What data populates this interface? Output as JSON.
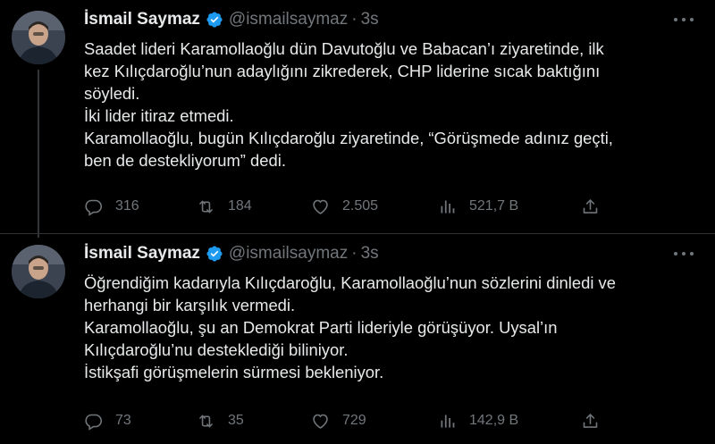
{
  "tweets": [
    {
      "author_name": "İsmail Saymaz",
      "handle": "@ismailsaymaz",
      "separator": "·",
      "time": "3s",
      "lines": [
        "Saadet lideri Karamollaoğlu dün Davutoğlu ve Babacan’ı ziyaretinde, ilk",
        "kez Kılıçdaroğlu’nun adaylığını zikrederek, CHP liderine sıcak baktığını",
        "söyledi.",
        "İki lider itiraz etmedi.",
        "Karamollaoğlu, bugün Kılıçdaroğlu ziyaretinde, “Görüşmede adınız geçti,",
        "ben de destekliyorum” dedi."
      ],
      "replies": "316",
      "retweets": "184",
      "likes": "2.505",
      "views": "521,7 B"
    },
    {
      "author_name": "İsmail Saymaz",
      "handle": "@ismailsaymaz",
      "separator": "·",
      "time": "3s",
      "lines": [
        "Öğrendiğim kadarıyla Kılıçdaroğlu, Karamollaoğlu’nun sözlerini dinledi ve",
        "herhangi bir karşılık vermedi.",
        "Karamollaoğlu, şu an Demokrat Parti lideriyle görüşüyor. Uysal’ın",
        "Kılıçdaroğlu’nu desteklediği biliniyor.",
        "İstikşafi görüşmelerin sürmesi bekleniyor."
      ],
      "replies": "73",
      "retweets": "35",
      "likes": "729",
      "views": "142,9 B"
    }
  ],
  "icons": {
    "verified": "verified-badge-icon",
    "more": "more-dots-icon",
    "reply": "reply-icon",
    "retweet": "retweet-icon",
    "like": "heart-icon",
    "views": "views-icon",
    "share": "share-icon"
  },
  "colors": {
    "background": "#000000",
    "text": "#e7e9ea",
    "muted": "#71767b",
    "verified": "#1d9bf0",
    "divider": "#2f3336"
  }
}
